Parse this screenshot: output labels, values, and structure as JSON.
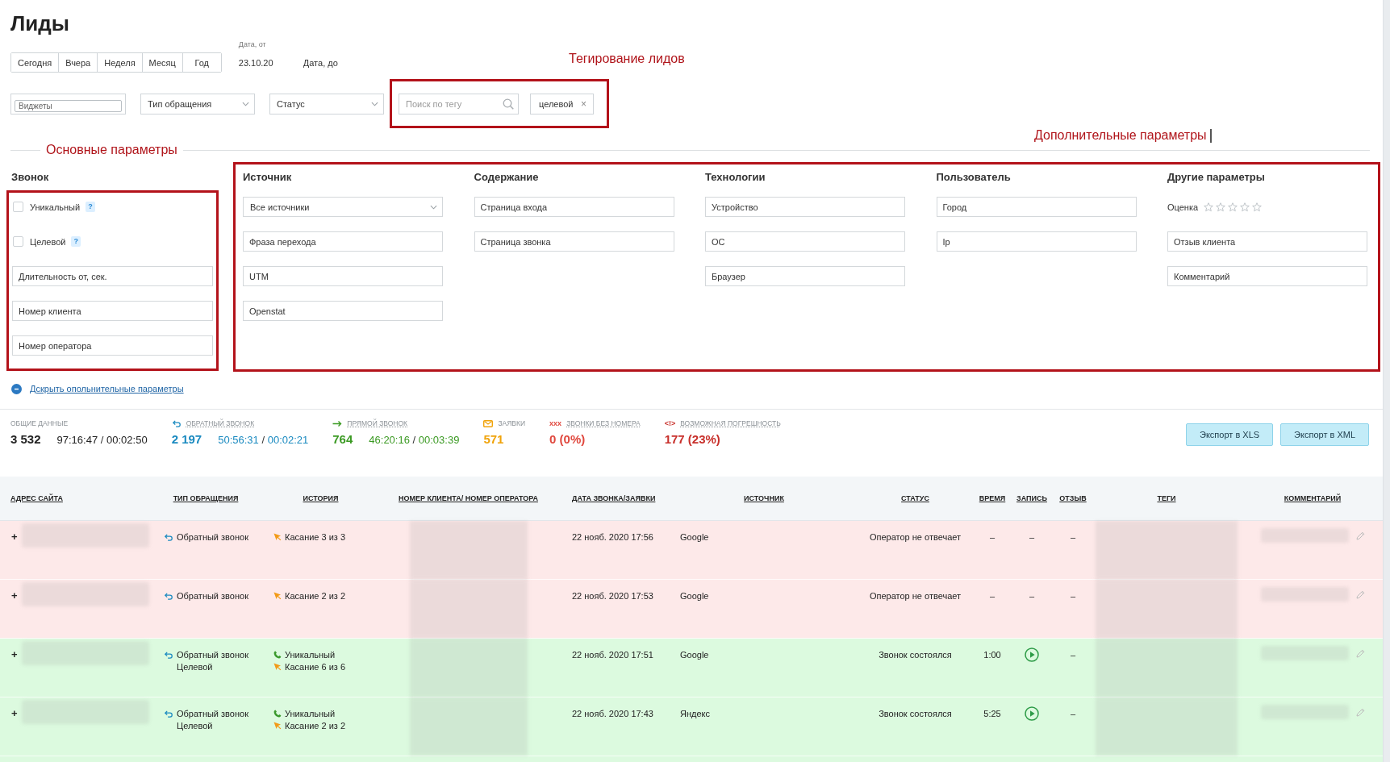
{
  "title": "Лиды",
  "period_buttons": [
    {
      "label": "Сегодня",
      "selected": false
    },
    {
      "label": "Вчера",
      "selected": false
    },
    {
      "label": "Неделя",
      "selected": false
    },
    {
      "label": "Месяц",
      "selected": false
    },
    {
      "label": "Год",
      "selected": false
    }
  ],
  "date_from": {
    "label": "Дата, от",
    "value": "23.10.20"
  },
  "date_to": {
    "placeholder": "Дата, до"
  },
  "tagging_annotation": "Тегирование лидов",
  "filters": {
    "widgets": {
      "placeholder": "Виджеты"
    },
    "selects": [
      {
        "placeholder": "Тип обращения"
      },
      {
        "placeholder": "Статус"
      }
    ]
  },
  "tag_filter": {
    "search": {
      "placeholder": "Поиск по тегу"
    },
    "tags": [
      {
        "label": "целевой",
        "remove": "×"
      }
    ]
  },
  "extra_annotation": "Дополнительные параметры",
  "main_annotation": "Основные параметры",
  "call_group": {
    "title": "Звонок",
    "checkboxes": [
      {
        "label": "Уникальный",
        "help": "?",
        "checked": false
      },
      {
        "label": "Целевой",
        "help": "?",
        "checked": false
      }
    ],
    "fields": [
      {
        "placeholder": "Длительность от, сек."
      },
      {
        "placeholder": "Номер клиента"
      },
      {
        "placeholder": "Номер оператора"
      }
    ]
  },
  "extra_groups": [
    {
      "title": "Источник",
      "fields": [
        {
          "kind": "select",
          "value": "Все источники"
        },
        {
          "kind": "input",
          "placeholder": "Фраза перехода"
        },
        {
          "kind": "input",
          "placeholder": "UTM"
        },
        {
          "kind": "input",
          "placeholder": "Openstat"
        }
      ]
    },
    {
      "title": "Содержание",
      "fields": [
        {
          "kind": "input",
          "placeholder": "Страница входа"
        },
        {
          "kind": "input",
          "placeholder": "Страница звонка"
        }
      ]
    },
    {
      "title": "Технологии",
      "fields": [
        {
          "kind": "input",
          "placeholder": "Устройство"
        },
        {
          "kind": "input",
          "placeholder": "ОС"
        },
        {
          "kind": "input",
          "placeholder": "Браузер"
        }
      ]
    },
    {
      "title": "Пользователь",
      "fields": [
        {
          "kind": "input",
          "placeholder": "Город"
        },
        {
          "kind": "input",
          "placeholder": "Ip"
        }
      ]
    },
    {
      "title": "Другие параметры",
      "fields": [
        {
          "kind": "rating",
          "label": "Оценка",
          "stars": 0
        },
        {
          "kind": "input",
          "placeholder": "Отзыв клиента"
        },
        {
          "kind": "input",
          "placeholder": "Комментарий"
        }
      ]
    }
  ],
  "collapse_link": "Дскрыть опольнительные параметры",
  "stats": [
    {
      "kind": "total",
      "label": "ОБЩИЕ ДАННЫЕ",
      "color": "#222222",
      "count": "3 532",
      "time_total": "97:16:47",
      "separator": "/",
      "time_avg": "00:02:50"
    },
    {
      "kind": "callback",
      "label": "ОБРАТНЫЙ ЗВОНОК",
      "color": "#1a8ac0",
      "count": "2 197",
      "time_total": "50:56:31",
      "separator": "/",
      "time_avg": "00:02:21"
    },
    {
      "kind": "direct",
      "label": "ПРЯМОЙ ЗВОНОК",
      "color": "#3b9a23",
      "count": "764",
      "time_total": "46:20:16",
      "separator": "/",
      "time_avg": "00:03:39"
    },
    {
      "kind": "requests",
      "label": "ЗАЯВКИ",
      "color": "#f0a30a",
      "count": "571"
    },
    {
      "kind": "no_number",
      "glyph": "xxx",
      "label": "ЗВОНКИ БЕЗ НОМЕРА",
      "color": "#e0483e",
      "count": "0 (0%)"
    },
    {
      "kind": "error",
      "glyph": "<!>",
      "label": "ВОЗМОЖНАЯ ПОГРЕШНОСТЬ",
      "color": "#c8302b",
      "count": "177 (23%)"
    }
  ],
  "export_buttons": [
    {
      "label": "Экспорт в XLS"
    },
    {
      "label": "Экспорт в XML"
    }
  ],
  "table": {
    "columns": [
      "АДРЕС САЙТА",
      "ТИП ОБРАЩЕНИЯ",
      "ИСТОРИЯ",
      "НОМЕР КЛИЕНТА/ НОМЕР ОПЕРАТОРА",
      "ДАТА ЗВОНКА/ЗАЯВКИ",
      "ИСТОЧНИК",
      "СТАТУС",
      "ВРЕМЯ",
      "ЗАПИСЬ",
      "ОТЗЫВ",
      "ТЕГИ",
      "КОММЕНТАРИЙ"
    ],
    "rows": [
      {
        "answered": false,
        "expand": "+",
        "type": {
          "kind": "callback",
          "lines": [
            "Обратный звонок"
          ]
        },
        "history": [
          {
            "kind": "touch",
            "text": "Касание 3 из 3"
          }
        ],
        "date": "22 нояб. 2020 17:56",
        "source": "Google",
        "status": "Оператор не отвечает",
        "duration": "–",
        "record": {
          "kind": "none",
          "text": "–"
        },
        "review": "–"
      },
      {
        "answered": false,
        "expand": "+",
        "type": {
          "kind": "callback",
          "lines": [
            "Обратный звонок"
          ]
        },
        "history": [
          {
            "kind": "touch",
            "text": "Касание 2 из 2"
          }
        ],
        "date": "22 нояб. 2020 17:53",
        "source": "Google",
        "status": "Оператор не отвечает",
        "duration": "–",
        "record": {
          "kind": "none",
          "text": "–"
        },
        "review": "–"
      },
      {
        "answered": true,
        "expand": "+",
        "type": {
          "kind": "callback",
          "lines": [
            "Обратный звонок",
            "Целевой"
          ]
        },
        "history": [
          {
            "kind": "unique",
            "text": "Уникальный"
          },
          {
            "kind": "touch",
            "text": "Касание 6 из 6"
          }
        ],
        "date": "22 нояб. 2020 17:51",
        "source": "Google",
        "status": "Звонок состоялся",
        "duration": "1:00",
        "record": {
          "kind": "play"
        },
        "review": "–"
      },
      {
        "answered": true,
        "expand": "+",
        "type": {
          "kind": "callback",
          "lines": [
            "Обратный звонок",
            "Целевой"
          ]
        },
        "history": [
          {
            "kind": "unique",
            "text": "Уникальный"
          },
          {
            "kind": "touch",
            "text": "Касание 2 из 2"
          }
        ],
        "date": "22 нояб. 2020 17:43",
        "source": "Яндекс",
        "status": "Звонок состоялся",
        "duration": "5:25",
        "record": {
          "kind": "play"
        },
        "review": "–"
      }
    ]
  }
}
